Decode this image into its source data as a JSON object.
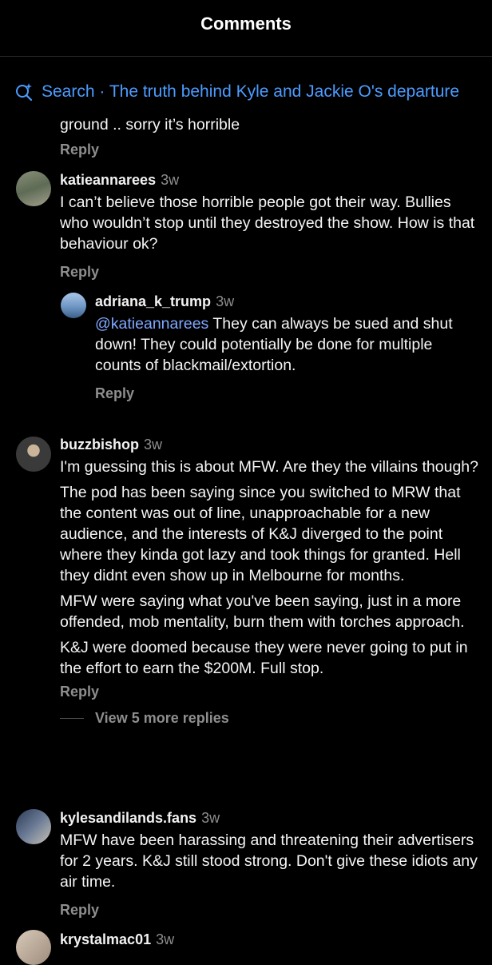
{
  "header": {
    "title": "Comments"
  },
  "search": {
    "text": "Search · The truth behind Kyle and Jackie O's departure"
  },
  "top_fragment": {
    "text": "ground .. sorry it’s horrible",
    "reply": "Reply"
  },
  "comments": [
    {
      "username": "katieannarees",
      "time": "3w",
      "text": "I can’t believe those horrible people got their way. Bullies who wouldn’t stop until they destroyed the show. How is that behaviour ok?",
      "reply": "Reply",
      "replies": [
        {
          "username": "adriana_k_trump",
          "time": "3w",
          "mention": "@katieannarees",
          "text": " They can always be sued and shut down! They could potentially be done for multiple counts of blackmail/extortion.",
          "reply": "Reply"
        }
      ]
    },
    {
      "username": "buzzbishop",
      "time": "3w",
      "paragraphs": [
        "I'm guessing this is about MFW. Are they the villains though?",
        "The pod has been saying since you switched to MRW that the content was out of line, unapproachable for a new audience, and the interests of K&J diverged to the point where they kinda got lazy and took things for granted. Hell they didnt even show up in Melbourne for months.",
        "MFW were saying what you've been saying, just in a more offended, mob mentality, burn them with torches approach.",
        "K&J were doomed because they were never going to put in the effort to earn the $200M. Full stop."
      ],
      "reply": "Reply",
      "view_more": "View 5 more replies"
    },
    {
      "username": "kylesandilands.fans",
      "time": "3w",
      "text": "MFW have been harassing and threatening their advertisers for 2 years. K&J still stood strong. Don't give these idiots any air time.",
      "reply": "Reply"
    },
    {
      "username": "krystalmac01",
      "time": "3w",
      "text": ""
    }
  ]
}
